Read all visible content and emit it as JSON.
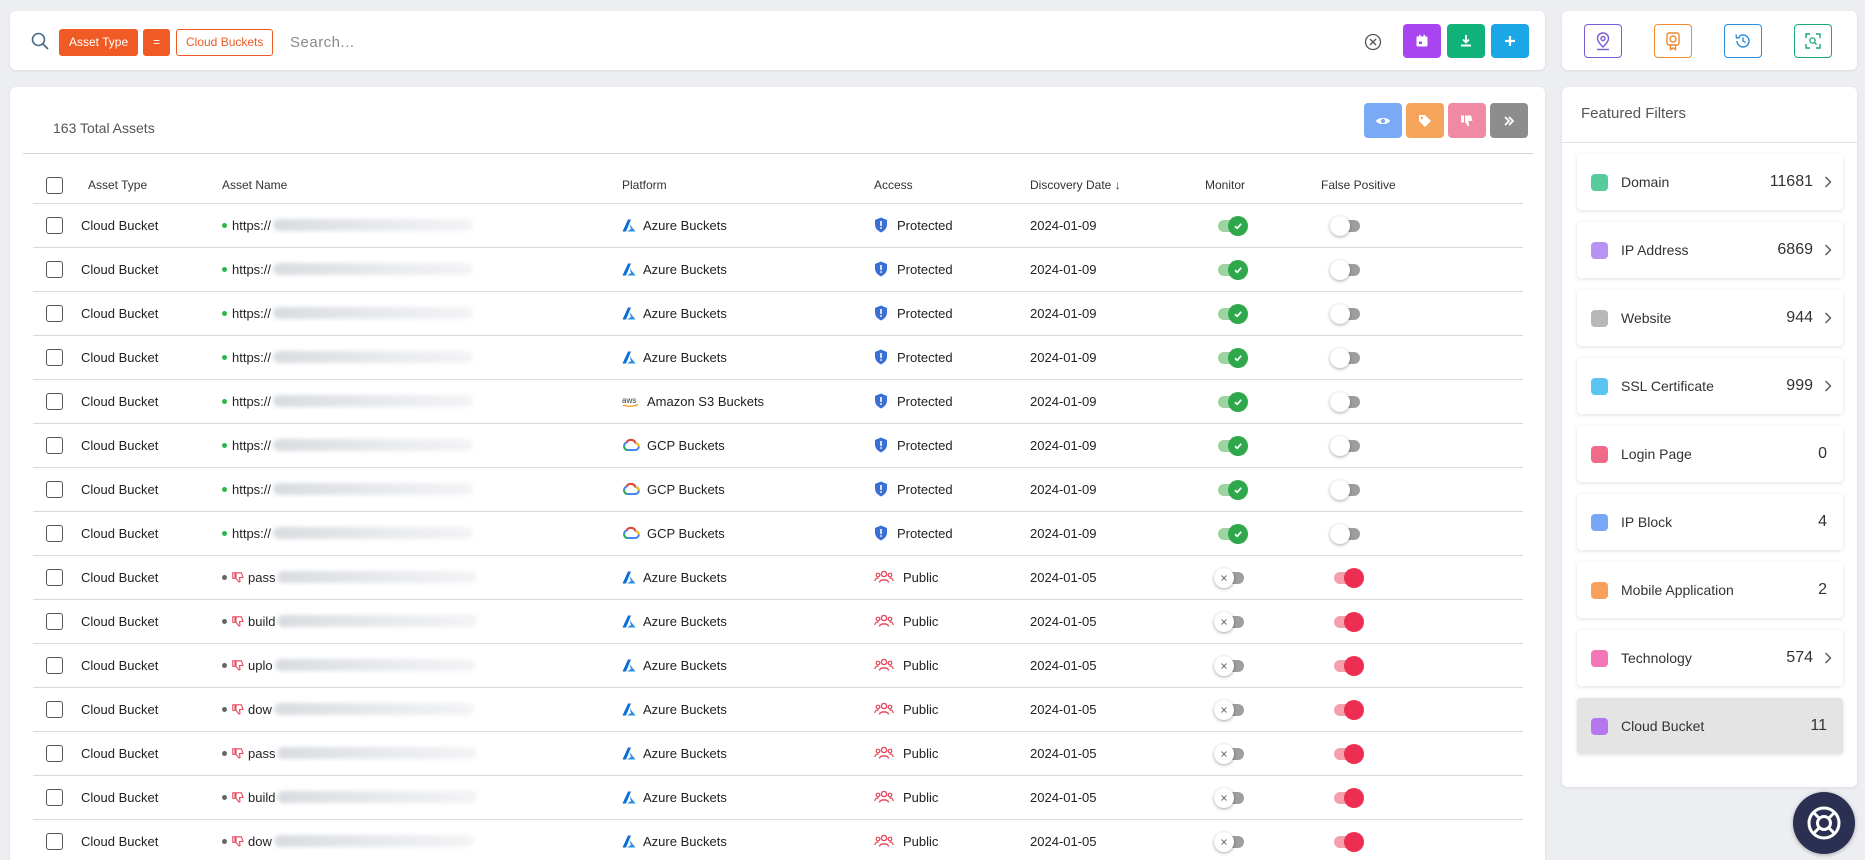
{
  "search": {
    "chips": {
      "key": "Asset Type",
      "operator": "=",
      "value": "Cloud Buckets"
    },
    "placeholder": "Search..."
  },
  "table": {
    "total_label": "163 Total Assets",
    "columns": [
      "Asset Type",
      "Asset Name",
      "Platform",
      "Access",
      "Discovery Date",
      "Monitor",
      "False Positive"
    ],
    "sort_indicator": "↓",
    "rows": [
      {
        "type": "Cloud Bucket",
        "name_prefix": "https://",
        "status": "active",
        "platform": "Azure Buckets",
        "platform_icon": "azure-icon",
        "access": "Protected",
        "date": "2024-01-09",
        "monitor": true,
        "false_positive": false
      },
      {
        "type": "Cloud Bucket",
        "name_prefix": "https://",
        "status": "active",
        "platform": "Azure Buckets",
        "platform_icon": "azure-icon",
        "access": "Protected",
        "date": "2024-01-09",
        "monitor": true,
        "false_positive": false
      },
      {
        "type": "Cloud Bucket",
        "name_prefix": "https://",
        "status": "active",
        "platform": "Azure Buckets",
        "platform_icon": "azure-icon",
        "access": "Protected",
        "date": "2024-01-09",
        "monitor": true,
        "false_positive": false
      },
      {
        "type": "Cloud Bucket",
        "name_prefix": "https://",
        "status": "active",
        "platform": "Azure Buckets",
        "platform_icon": "azure-icon",
        "access": "Protected",
        "date": "2024-01-09",
        "monitor": true,
        "false_positive": false
      },
      {
        "type": "Cloud Bucket",
        "name_prefix": "https://",
        "status": "active",
        "platform": "Amazon S3 Buckets",
        "platform_icon": "aws-icon",
        "access": "Protected",
        "date": "2024-01-09",
        "monitor": true,
        "false_positive": false
      },
      {
        "type": "Cloud Bucket",
        "name_prefix": "https://",
        "status": "active",
        "platform": "GCP Buckets",
        "platform_icon": "gcp-icon",
        "access": "Protected",
        "date": "2024-01-09",
        "monitor": true,
        "false_positive": false
      },
      {
        "type": "Cloud Bucket",
        "name_prefix": "https://",
        "status": "active",
        "platform": "GCP Buckets",
        "platform_icon": "gcp-icon",
        "access": "Protected",
        "date": "2024-01-09",
        "monitor": true,
        "false_positive": false
      },
      {
        "type": "Cloud Bucket",
        "name_prefix": "https://",
        "status": "active",
        "platform": "GCP Buckets",
        "platform_icon": "gcp-icon",
        "access": "Protected",
        "date": "2024-01-09",
        "monitor": true,
        "false_positive": false
      },
      {
        "type": "Cloud Bucket",
        "name_prefix": "pass",
        "status": "false-positive",
        "platform": "Azure Buckets",
        "platform_icon": "azure-icon",
        "access": "Public",
        "date": "2024-01-05",
        "monitor": false,
        "false_positive": true
      },
      {
        "type": "Cloud Bucket",
        "name_prefix": "build",
        "status": "false-positive",
        "platform": "Azure Buckets",
        "platform_icon": "azure-icon",
        "access": "Public",
        "date": "2024-01-05",
        "monitor": false,
        "false_positive": true
      },
      {
        "type": "Cloud Bucket",
        "name_prefix": "uplo",
        "status": "false-positive",
        "platform": "Azure Buckets",
        "platform_icon": "azure-icon",
        "access": "Public",
        "date": "2024-01-05",
        "monitor": false,
        "false_positive": true
      },
      {
        "type": "Cloud Bucket",
        "name_prefix": "dow",
        "status": "false-positive",
        "platform": "Azure Buckets",
        "platform_icon": "azure-icon",
        "access": "Public",
        "date": "2024-01-05",
        "monitor": false,
        "false_positive": true
      },
      {
        "type": "Cloud Bucket",
        "name_prefix": "pass",
        "status": "false-positive",
        "platform": "Azure Buckets",
        "platform_icon": "azure-icon",
        "access": "Public",
        "date": "2024-01-05",
        "monitor": false,
        "false_positive": true
      },
      {
        "type": "Cloud Bucket",
        "name_prefix": "build",
        "status": "false-positive",
        "platform": "Azure Buckets",
        "platform_icon": "azure-icon",
        "access": "Public",
        "date": "2024-01-05",
        "monitor": false,
        "false_positive": true
      },
      {
        "type": "Cloud Bucket",
        "name_prefix": "dow",
        "status": "false-positive",
        "platform": "Azure Buckets",
        "platform_icon": "azure-icon",
        "access": "Public",
        "date": "2024-01-05",
        "monitor": false,
        "false_positive": true
      }
    ]
  },
  "featured_filters": {
    "title": "Featured Filters",
    "items": [
      {
        "label": "Domain",
        "count": "11681",
        "color": "#55cc99",
        "chevron": true,
        "active": false
      },
      {
        "label": "IP Address",
        "count": "6869",
        "color": "#b794f4",
        "chevron": true,
        "active": false
      },
      {
        "label": "Website",
        "count": "944",
        "color": "#b8b8b8",
        "chevron": true,
        "active": false
      },
      {
        "label": "SSL Certificate",
        "count": "999",
        "color": "#5bc4f0",
        "chevron": true,
        "active": false
      },
      {
        "label": "Login Page",
        "count": "0",
        "color": "#f06a8a",
        "chevron": false,
        "active": false
      },
      {
        "label": "IP Block",
        "count": "4",
        "color": "#78a7f5",
        "chevron": false,
        "active": false
      },
      {
        "label": "Mobile Application",
        "count": "2",
        "color": "#f8a05c",
        "chevron": false,
        "active": false
      },
      {
        "label": "Technology",
        "count": "574",
        "color": "#f276b8",
        "chevron": true,
        "active": false
      },
      {
        "label": "Cloud Bucket",
        "count": "11",
        "color": "#b477f0",
        "chevron": false,
        "active": true
      }
    ]
  },
  "colors": {
    "accent_orange": "#f05a24",
    "purple": "#a844f0",
    "green": "#10b27a",
    "blue": "#1ba6e6"
  }
}
